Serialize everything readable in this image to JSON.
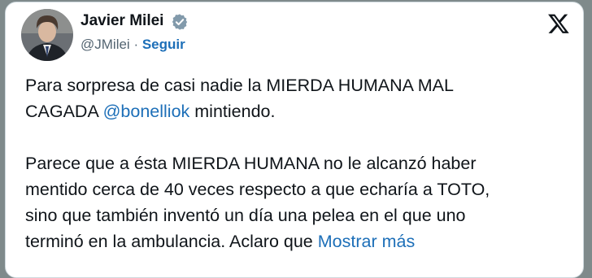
{
  "author": {
    "display_name": "Javier Milei",
    "handle": "@JMilei",
    "separator": " · ",
    "follow_label": "Seguir",
    "verified": true
  },
  "platform": {
    "logo_icon": "x-logo-icon"
  },
  "tweet": {
    "p1_line1": "Para sorpresa de casi nadie la MIERDA HUMANA MAL",
    "p1_line2_start": "CAGADA ",
    "mention": "@bonelliok",
    "p1_line2_end": " mintiendo.",
    "p2_line1": "Parece que a ésta MIERDA HUMANA no le alcanzó haber",
    "p2_line2": "mentido cerca de 40 veces respecto a que echaría a TOTO,",
    "p2_line3": "sino que también inventó un día una pelea en el que uno",
    "p2_line4_start": "terminó en la ambulancia. Aclaro que ",
    "show_more_label": "Mostrar más"
  },
  "colors": {
    "link": "#1d6fb8",
    "text": "#0f1419",
    "muted": "#536471",
    "verified_badge": "#829aab"
  }
}
